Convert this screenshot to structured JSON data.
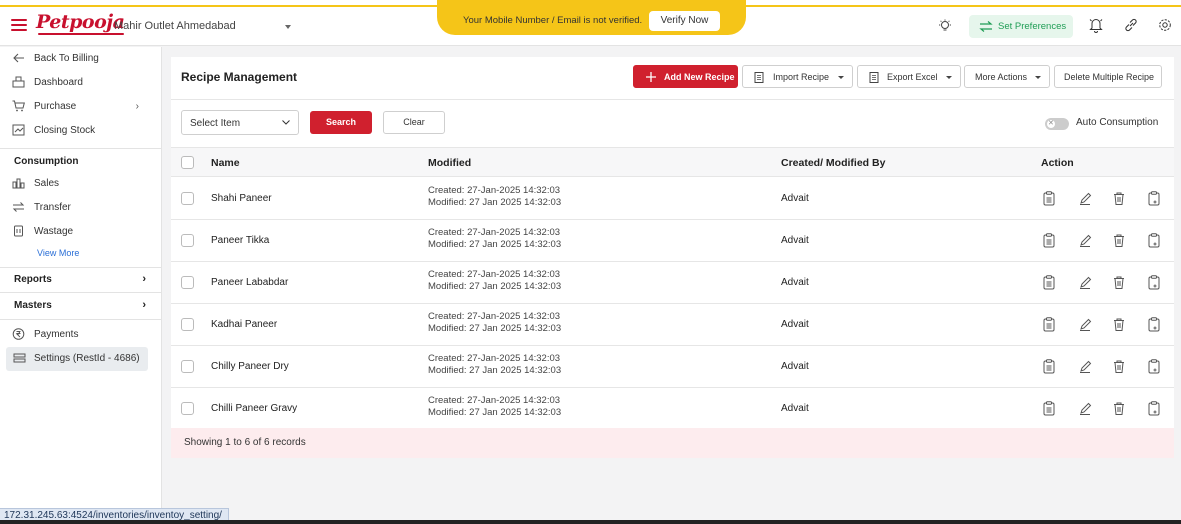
{
  "header": {
    "logo_text": "Petpooja",
    "outlet_name": "Mahir Outlet Ahmedabad",
    "verify_message": "Your Mobile Number / Email is not verified.",
    "verify_button": "Verify Now",
    "set_preferences": "Set Preferences",
    "accent_color": "#d0202e",
    "banner_color": "#f5c518"
  },
  "sidebar": {
    "back_to_billing": "Back To Billing",
    "dashboard": "Dashboard",
    "purchase": "Purchase",
    "closing_stock": "Closing Stock",
    "consumption_title": "Consumption",
    "sales": "Sales",
    "transfer": "Transfer",
    "wastage": "Wastage",
    "view_more": "View More",
    "reports": "Reports",
    "masters": "Masters",
    "payments": "Payments",
    "settings": "Settings (RestId - 4686)"
  },
  "toolbar": {
    "title": "Recipe Management",
    "add_new_recipe": "Add New Recipe",
    "import_recipe": "Import Recipe",
    "export_excel": "Export Excel",
    "more_actions": "More Actions",
    "delete_multiple": "Delete Multiple Recipe"
  },
  "filters": {
    "select_item": "Select Item",
    "search": "Search",
    "clear": "Clear",
    "auto_consumption": "Auto Consumption",
    "auto_consumption_on": false
  },
  "table": {
    "headers": {
      "name": "Name",
      "modified": "Modified",
      "created_by": "Created/ Modified By",
      "action": "Action"
    },
    "rows": [
      {
        "name": "Shahi Paneer",
        "created": "Created: 27-Jan-2025 14:32:03",
        "modified": "Modified: 27 Jan 2025 14:32:03",
        "by": "Advait"
      },
      {
        "name": "Paneer Tikka",
        "created": "Created: 27-Jan-2025 14:32:03",
        "modified": "Modified: 27 Jan 2025 14:32:03",
        "by": "Advait"
      },
      {
        "name": "Paneer Lababdar",
        "created": "Created: 27-Jan-2025 14:32:03",
        "modified": "Modified: 27 Jan 2025 14:32:03",
        "by": "Advait"
      },
      {
        "name": "Kadhai Paneer",
        "created": "Created: 27-Jan-2025 14:32:03",
        "modified": "Modified: 27 Jan 2025 14:32:03",
        "by": "Advait"
      },
      {
        "name": "Chilly Paneer Dry",
        "created": "Created: 27-Jan-2025 14:32:03",
        "modified": "Modified: 27 Jan 2025 14:32:03",
        "by": "Advait"
      },
      {
        "name": "Chilli Paneer Gravy",
        "created": "Created: 27-Jan-2025 14:32:03",
        "modified": "Modified: 27 Jan 2025 14:32:03",
        "by": "Advait"
      }
    ],
    "footer": "Showing 1 to 6 of 6 records"
  },
  "status_url": "172.31.245.63:4524/inventories/inventoy_setting/"
}
